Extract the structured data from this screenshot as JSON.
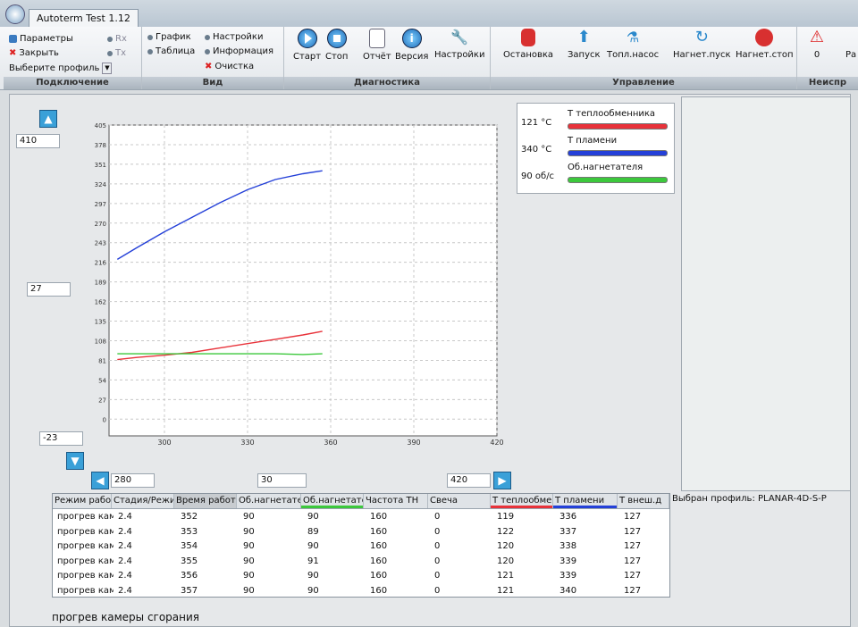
{
  "window": {
    "title": "Autoterm Test 1.12"
  },
  "ribbon": {
    "connection": {
      "label": "Подключение",
      "params": "Параметры",
      "close": "Закрыть",
      "profile": "Выберите профиль",
      "rx": "Rx",
      "tx": "Tx"
    },
    "view": {
      "label": "Вид",
      "graph": "График",
      "table": "Таблица",
      "settings": "Настройки",
      "info": "Информация",
      "clear": "Очистка"
    },
    "diagnostics": {
      "label": "Диагностика",
      "start": "Старт",
      "stop": "Стоп",
      "report": "Отчёт",
      "version": "Версия",
      "settings": "Настройки"
    },
    "control": {
      "label": "Управление",
      "stop": "Остановка",
      "launch": "Запуск",
      "fuel_pump": "Топл.насос",
      "blower_start": "Нагнет.пуск",
      "blower_stop": "Нагнет.стоп"
    },
    "faults": {
      "label": "Неиспр",
      "count": "0",
      "more": "Ра"
    }
  },
  "graph_controls": {
    "y_max": "410",
    "y_step": "27",
    "y_min": "-23",
    "x_min": "280",
    "x_step": "30",
    "x_max": "420"
  },
  "legend": [
    {
      "value": "121 °C",
      "name": "Т теплообменника",
      "color": "#e8323a"
    },
    {
      "value": "340 °C",
      "name": "Т пламени",
      "color": "#2440d8"
    },
    {
      "value": "90 об/с",
      "name": "Об.нагнетателя",
      "color": "#3cc83c"
    }
  ],
  "chart_data": {
    "type": "line",
    "xlim": [
      280,
      420
    ],
    "ylim": [
      -23,
      405
    ],
    "x_ticks": [
      300,
      330,
      360,
      390,
      420
    ],
    "y_ticks": [
      405,
      378,
      351,
      324,
      297,
      270,
      243,
      216,
      189,
      162,
      135,
      108,
      81,
      54,
      27,
      0
    ],
    "grid": true,
    "series": [
      {
        "name": "Т пламени",
        "color": "#2440d8",
        "x": [
          283,
          290,
          300,
          310,
          320,
          330,
          340,
          350,
          357
        ],
        "y": [
          220,
          236,
          258,
          278,
          298,
          316,
          330,
          338,
          342
        ]
      },
      {
        "name": "Т теплообменника",
        "color": "#e8323a",
        "x": [
          283,
          290,
          300,
          310,
          320,
          330,
          340,
          350,
          357
        ],
        "y": [
          82,
          85,
          88,
          92,
          98,
          104,
          110,
          116,
          121
        ]
      },
      {
        "name": "Об.нагнетателя",
        "color": "#3cc83c",
        "x": [
          283,
          290,
          300,
          310,
          320,
          330,
          340,
          350,
          357
        ],
        "y": [
          90,
          90,
          90,
          90,
          90,
          90,
          90,
          89,
          90
        ]
      }
    ]
  },
  "table": {
    "headers": [
      "Режим работы",
      "Стадия/Режим",
      "Время работы",
      "Об.нагнетателя",
      "Об.нагнетателя",
      "Частота ТН",
      "Свеча",
      "Т теплообменника",
      "Т пламени",
      "Т внеш.д"
    ],
    "rows": [
      [
        "прогрев камеры",
        "2.4",
        "352",
        "90",
        "90",
        "160",
        "0",
        "119",
        "336",
        "127"
      ],
      [
        "прогрев камеры",
        "2.4",
        "353",
        "90",
        "89",
        "160",
        "0",
        "122",
        "337",
        "127"
      ],
      [
        "прогрев камеры",
        "2.4",
        "354",
        "90",
        "90",
        "160",
        "0",
        "120",
        "338",
        "127"
      ],
      [
        "прогрев камеры",
        "2.4",
        "355",
        "90",
        "91",
        "160",
        "0",
        "120",
        "339",
        "127"
      ],
      [
        "прогрев камеры",
        "2.4",
        "356",
        "90",
        "90",
        "160",
        "0",
        "121",
        "339",
        "127"
      ],
      [
        "прогрев камеры",
        "2.4",
        "357",
        "90",
        "90",
        "160",
        "0",
        "121",
        "340",
        "127"
      ]
    ]
  },
  "profile_text": "Выбран профиль: PLANAR-4D-S-P",
  "status_text": "прогрев камеры сгорания"
}
